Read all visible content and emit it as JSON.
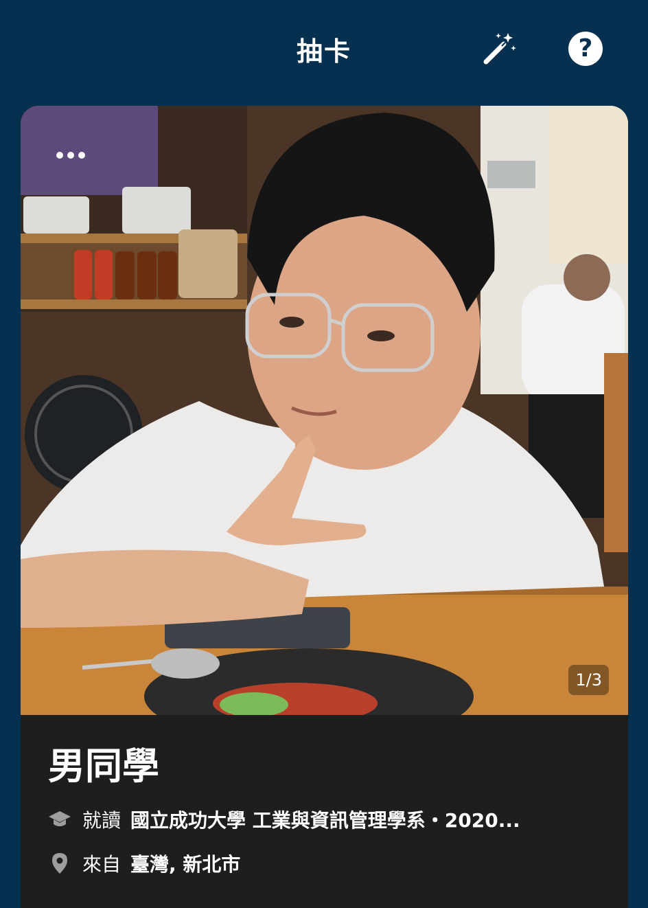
{
  "colors": {
    "background": "#06304f",
    "card_info": "#1e1e1e",
    "text": "#ffffff"
  },
  "header": {
    "title": "抽卡",
    "wand_icon": "magic-wand-icon",
    "help_icon": "question-circle-icon",
    "help_glyph": "?"
  },
  "card": {
    "more_icon": "more-dots-icon",
    "photo_counter": "1/3",
    "name": "男同學",
    "education": {
      "icon": "graduation-cap-icon",
      "prefix": "就讀",
      "value": "國立成功大學 工業與資訊管理學系・2020..."
    },
    "location": {
      "icon": "map-pin-icon",
      "prefix": "來自",
      "value": "臺灣, 新北市"
    }
  }
}
